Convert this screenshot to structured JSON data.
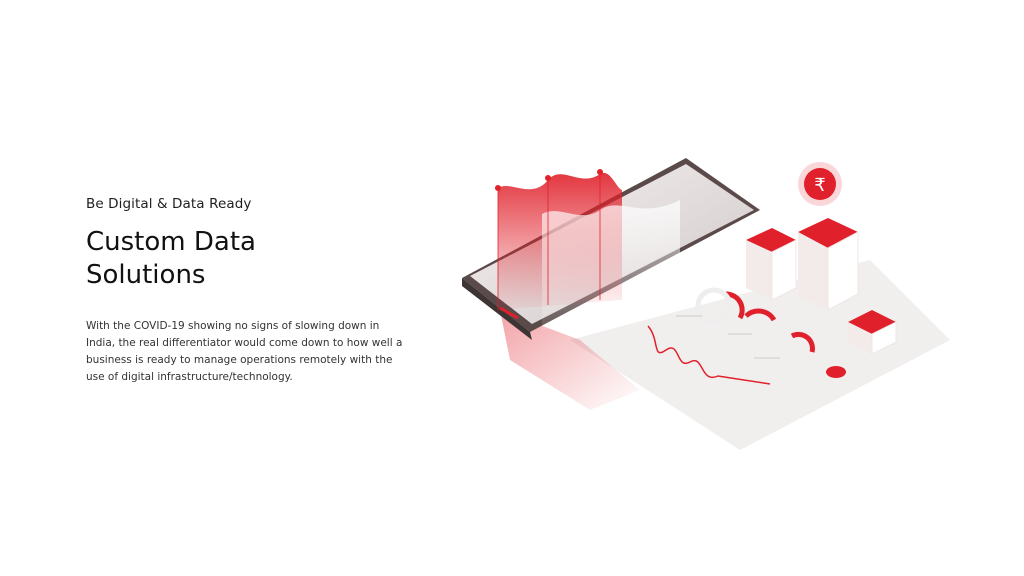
{
  "hero": {
    "eyebrow": "Be Digital & Data Ready",
    "title_line1": "Custom Data",
    "title_line2": "Solutions",
    "body": "With the COVID-19 showing no signs of slowing down in India, the real differentiator would come down to how well a business is ready to manage operations remotely with the use of digital infrastructure/technology."
  },
  "illustration": {
    "currency_symbol": "₹",
    "accent_color": "#e0202a"
  }
}
